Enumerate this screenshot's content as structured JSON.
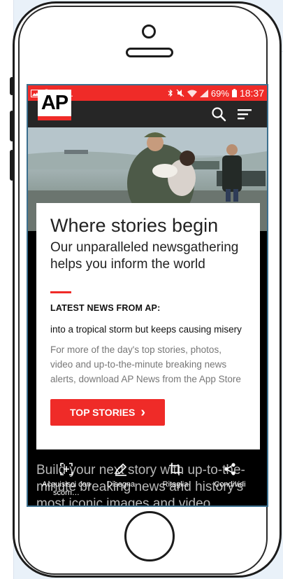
{
  "status_bar": {
    "ellipsis": "...",
    "battery": "69%",
    "time": "18:37"
  },
  "header": {
    "logo": "AP"
  },
  "card": {
    "title": "Where stories begin",
    "subtitle": "Our unparalleled newsgathering helps you inform the world",
    "latest_label": "LATEST NEWS FROM AP:",
    "ticker": "into a tropical storm but keeps causing misery",
    "body": "For more of the day's top stories, photos, video and up-to-the-minute breaking news alerts, download AP News from the App Store",
    "cta": "TOP STORIES",
    "cta_chevron": "›"
  },
  "below_card_text": "Build your next story with up-to-the-minute breaking news and history's most iconic images and video.",
  "action_bar": {
    "capture_label": "Acquisisci con scorri…",
    "draw_label": "Disegna",
    "crop_label": "Ritaglia",
    "share_label": "Condividi"
  },
  "colors": {
    "accent_red": "#ef2b28",
    "header_dark": "#262626"
  }
}
